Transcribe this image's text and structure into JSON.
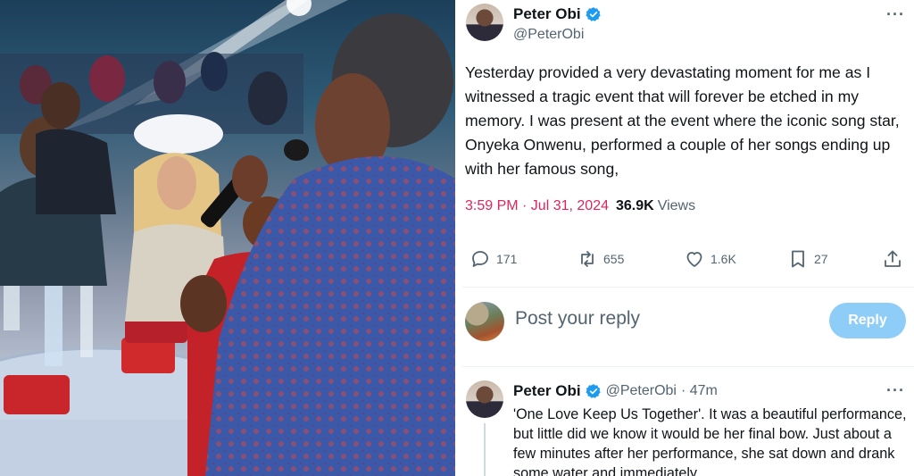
{
  "photo": {
    "alt": "Event photo"
  },
  "tweet": {
    "author_name": "Peter Obi",
    "author_handle": "@PeterObi",
    "more_label": "···",
    "text": "Yesterday provided a very devastating moment for me as I witnessed a tragic event that will forever be etched in my memory. I was present at the event where the iconic song star, Onyeka Onwenu, performed a couple of her songs ending up with her famous song,",
    "time": "3:59 PM · Jul 31, 2024",
    "time_sep": " · ",
    "views_count": "36.9K",
    "views_label": "Views",
    "actions": {
      "replies": "171",
      "reposts": "655",
      "likes": "1.6K",
      "bookmarks": "27"
    }
  },
  "composer": {
    "placeholder": "Post your reply",
    "button_label": "Reply"
  },
  "reply": {
    "author_name": "Peter Obi",
    "author_handle": "@PeterObi",
    "age": "· 47m",
    "more_label": "···",
    "text": "'One Love Keep Us Together'. It was a beautiful performance, but little did we know it would be her final bow. Just about a few minutes after her performance, she sat down and drank some water and immediately"
  },
  "colors": {
    "accent_link": "#e0245e",
    "verified": "#1d9bf0",
    "reply_button": "#8ecdf8",
    "secondary_text": "#536471"
  }
}
